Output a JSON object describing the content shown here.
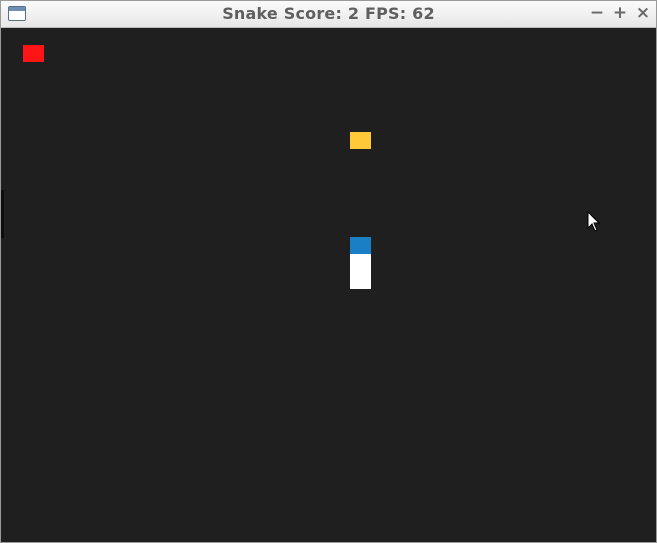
{
  "window": {
    "title": "Snake Score: 2 FPS: 62",
    "controls": {
      "minimize": "−",
      "maximize": "+",
      "close": "×"
    }
  },
  "game": {
    "background_color": "#1f1f1f",
    "score": 2,
    "fps": 62,
    "items": {
      "food_red": {
        "color": "#ff1515"
      },
      "food_yellow": {
        "color": "#ffc93a"
      },
      "snake_head": {
        "color": "#1a7fc4"
      },
      "snake_body": {
        "color": "#ffffff"
      }
    },
    "cursor_icon": "arrow-pointer-icon"
  }
}
